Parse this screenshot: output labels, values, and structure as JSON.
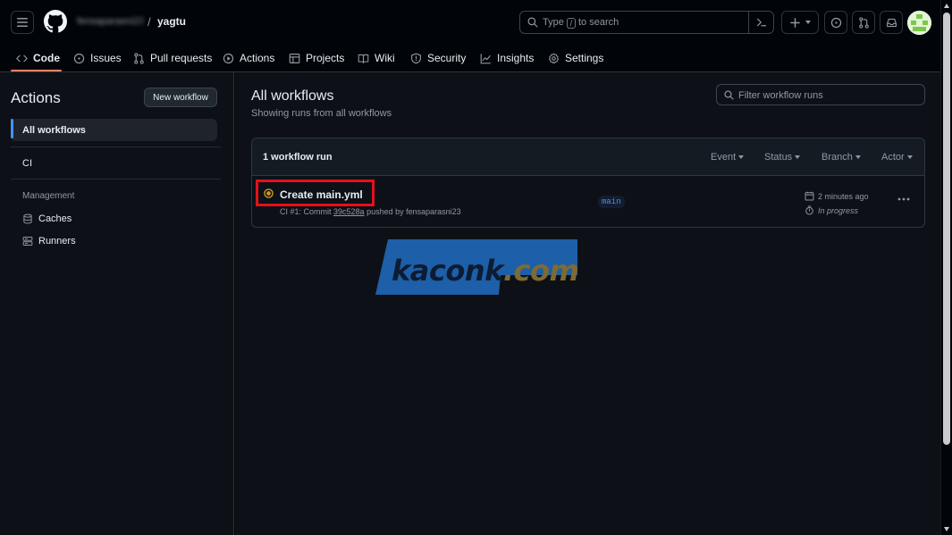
{
  "header": {
    "owner": "fensaparasni23",
    "separator": "/",
    "repo": "yagtu",
    "search": {
      "prefix": "Type",
      "key": "/",
      "suffix": "to search"
    }
  },
  "tabs": [
    {
      "label": "Code",
      "icon": "code-icon",
      "active": true
    },
    {
      "label": "Issues",
      "icon": "issue-icon"
    },
    {
      "label": "Pull requests",
      "icon": "pull-request-icon"
    },
    {
      "label": "Actions",
      "icon": "play-icon"
    },
    {
      "label": "Projects",
      "icon": "table-icon"
    },
    {
      "label": "Wiki",
      "icon": "book-icon"
    },
    {
      "label": "Security",
      "icon": "shield-icon"
    },
    {
      "label": "Insights",
      "icon": "graph-icon"
    },
    {
      "label": "Settings",
      "icon": "gear-icon"
    }
  ],
  "sidebar": {
    "title": "Actions",
    "new_workflow_label": "New workflow",
    "items": [
      {
        "label": "All workflows",
        "active": true
      },
      {
        "label": "CI"
      }
    ],
    "section_label": "Management",
    "management": [
      {
        "label": "Caches",
        "icon": "database-icon"
      },
      {
        "label": "Runners",
        "icon": "server-icon"
      }
    ]
  },
  "main": {
    "title": "All workflows",
    "subtitle": "Showing runs from all workflows",
    "filter_placeholder": "Filter workflow runs",
    "runs_count": "1 workflow run",
    "filters": [
      "Event",
      "Status",
      "Branch",
      "Actor"
    ],
    "runs": [
      {
        "title": "Create main.yml",
        "status": "in-progress",
        "meta_prefix": "CI #1: Commit",
        "commit": "39c528a",
        "meta_suffix": "pushed by fensaparasni23",
        "branch": "main",
        "time": "2 minutes ago",
        "state": "In progress"
      }
    ]
  },
  "watermark": {
    "text_main": "kaconk",
    "text_tld": ".com"
  },
  "colors": {
    "accent_tab": "#f78166",
    "link_blue": "#4493f8",
    "in_progress": "#d29922",
    "highlight_red": "#e5101b",
    "watermark_blue": "#1d5fa8"
  }
}
